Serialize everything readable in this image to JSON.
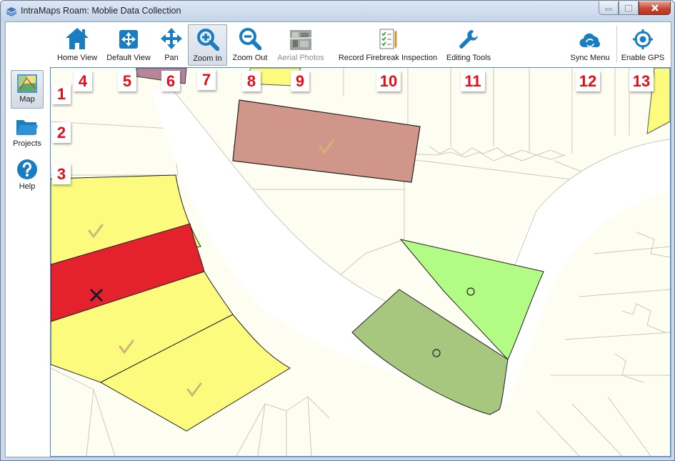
{
  "window": {
    "title": "IntraMaps Roam: Moblie Data Collection"
  },
  "toolbar": {
    "items": [
      {
        "label": "Home View",
        "icon": "home-icon"
      },
      {
        "label": "Default View",
        "icon": "default-view-icon"
      },
      {
        "label": "Pan",
        "icon": "pan-arrows-icon"
      },
      {
        "label": "Zoom In",
        "icon": "zoom-in-icon",
        "active": true
      },
      {
        "label": "Zoom Out",
        "icon": "zoom-out-icon"
      },
      {
        "label": "Aerial Photos",
        "icon": "aerial-photo-icon",
        "disabled": true
      },
      {
        "label": "Record Firebreak Inspection",
        "icon": "checklist-form-icon"
      },
      {
        "label": "Editing Tools",
        "icon": "wrench-icon"
      },
      {
        "label": "Sync Menu",
        "icon": "cloud-sync-icon"
      },
      {
        "label": "Enable GPS",
        "icon": "gps-crosshair-icon"
      }
    ]
  },
  "sidebar": {
    "items": [
      {
        "label": "Map",
        "icon": "map-icon",
        "active": true
      },
      {
        "label": "Projects",
        "icon": "folder-icon"
      },
      {
        "label": "Help",
        "icon": "help-icon"
      }
    ]
  },
  "callouts": [
    "1",
    "2",
    "3",
    "4",
    "5",
    "6",
    "7",
    "8",
    "9",
    "10",
    "11",
    "12",
    "13"
  ],
  "map": {
    "colors": {
      "parcel_background": "#fdfdf2",
      "parcel_lines": "#c9c9bb",
      "road": "#ffffff",
      "compliant_yellow": "#fcfb7e",
      "noncompliant_red": "#e3222d",
      "inspected_brown": "#d1968a",
      "pending_green": "#b2fb84",
      "pending_olive": "#a7c77f",
      "check_mark": "#d0b576"
    }
  }
}
